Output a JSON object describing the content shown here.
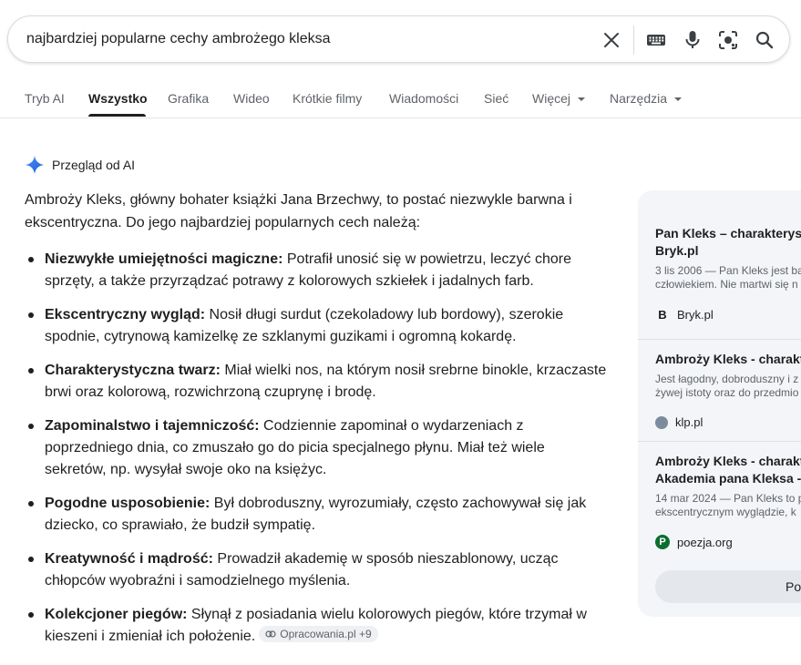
{
  "search": {
    "query": "najbardziej popularne cechy ambrożego kleksa",
    "icons": [
      "close-icon",
      "keyboard-icon",
      "microphone-icon",
      "lens-icon",
      "search-icon"
    ]
  },
  "tabs": [
    {
      "label": "Tryb AI",
      "active": false
    },
    {
      "label": "Wszystko",
      "active": true
    },
    {
      "label": "Grafika",
      "active": false
    },
    {
      "label": "Wideo",
      "active": false
    },
    {
      "label": "Krótkie filmy",
      "active": false
    },
    {
      "label": "Wiadomości",
      "active": false
    },
    {
      "label": "Sieć",
      "active": false
    },
    {
      "label": "Więcej",
      "active": false
    },
    {
      "label": "Narzędzia",
      "active": false
    }
  ],
  "ai_overview": {
    "title": "Przegląd od AI",
    "intro": "Ambroży Kleks, główny bohater książki Jana Brzechwy, to postać niezwykle barwna i ekscentryczna. Do jego najbardziej popularnych cech należą:",
    "points": [
      {
        "bold": "Niezwykłe umiejętności magiczne:",
        "text": " Potrafił unosić się w powietrzu, leczyć chore sprzęty, a także przyrządzać potrawy z kolorowych szkiełek i jadalnych farb."
      },
      {
        "bold": "Ekscentryczny wygląd:",
        "text": " Nosił długi surdut (czekoladowy lub bordowy), szerokie spodnie, cytrynową kamizelkę ze szklanymi guzikami i ogromną kokardę."
      },
      {
        "bold": "Charakterystyczna twarz:",
        "text": " Miał wielki nos, na którym nosił srebrne binokle, krzaczaste brwi oraz kolorową, rozwichrzoną czuprynę i brodę."
      },
      {
        "bold": "Zapominalstwo i tajemniczość:",
        "text": " Codziennie zapominał o wydarzeniach z poprzedniego dnia, co zmuszało go do picia specjalnego płynu. Miał też wiele sekretów, np. wysyłał swoje oko na księżyc."
      },
      {
        "bold": "Pogodne usposobienie:",
        "text": " Był dobroduszny, wyrozumiały, często zachowywał się jak dziecko, co sprawiało, że budził sympatię."
      },
      {
        "bold": "Kreatywność i mądrość:",
        "text": " Prowadził akademię w sposób nieszablonowy, ucząc chłopców wyobraźni i samodzielnego myślenia."
      },
      {
        "bold": "Kolekcjoner piegów:",
        "text": " Słynął z posiadania wielu kolorowych piegów, które trzymał w kieszeni i zmieniał ich położenie."
      }
    ],
    "source_chip": "Opracowania.pl +9"
  },
  "sources": [
    {
      "title_lines": [
        "Pan Kleks – charakterys",
        "Bryk.pl"
      ],
      "snippet_lines": [
        "3 lis 2006 — Pan Kleks jest ba",
        "człowiekiem. Nie martwi się n"
      ],
      "site": "Bryk.pl",
      "favicon": "B",
      "favicon_color": "#1a1a1a"
    },
    {
      "title_lines": [
        "Ambroży Kleks - charakt"
      ],
      "snippet_lines": [
        "Jest łagodny, dobroduszny i z",
        "żywej istoty oraz do przedmio"
      ],
      "site": "klp.pl",
      "favicon": "",
      "favicon_color": "#7c8c9c"
    },
    {
      "title_lines": [
        "Ambroży Kleks - charakt",
        "Akademia pana Kleksa -"
      ],
      "snippet_lines": [
        "14 mar 2024 — Pan Kleks to p",
        "ekscentrycznym wyglądzie, k"
      ],
      "site": "poezja.org",
      "favicon": "P",
      "favicon_color": "#0b6e2e"
    }
  ],
  "more_button": "Po"
}
